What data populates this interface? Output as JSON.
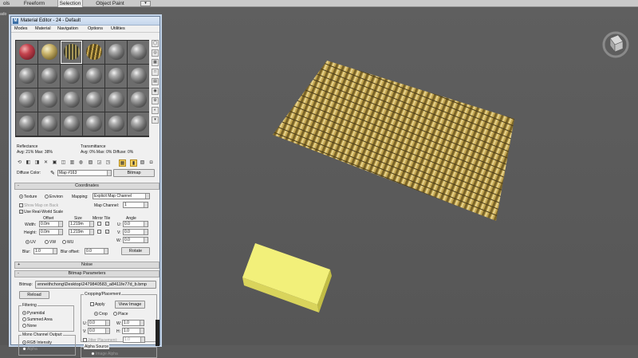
{
  "ribbon": {
    "tabs": [
      "ols",
      "Freeform",
      "Selection",
      "Object Paint"
    ],
    "selected": "Selection",
    "dropdown_glyph": "▾"
  },
  "viewport": {
    "label": "ado"
  },
  "material_editor": {
    "title": "Material Editor - 24 - Default",
    "title_icon": "M",
    "menu": [
      "Modes",
      "Material",
      "Navigation",
      "Options",
      "Utilities"
    ],
    "stats": {
      "reflectance_label": "Reflectance",
      "reflectance_values": "Avg:  21% Max:  38%",
      "transmittance_label": "Transmittance",
      "transmittance_values": "Avg:   0% Max:   0%  Diffuse:   0%"
    },
    "diffuse": {
      "label": "Diffuse Color:",
      "map_name": "Map #163",
      "type": "Bitmap"
    },
    "coordinates": {
      "header": "Coordinates",
      "texture": "Texture",
      "environ": "Environ",
      "mapping_label": "Mapping:",
      "mapping_value": "Explicit Map Channel",
      "show_map_on_back": "Show Map on Back",
      "map_channel_label": "Map Channel:",
      "map_channel_value": "1",
      "use_real_world_scale": "Use Real-World Scale",
      "offset_header": "Offset",
      "size_header": "Size",
      "mirror_tile_header": "Mirror Tile",
      "angle_header": "Angle",
      "width_label": "Width:",
      "width_offset": "0.0m",
      "width_size": "1.219m",
      "height_label": "Height:",
      "height_offset": "0.0m",
      "height_size": "1.219m",
      "u_label": "U:",
      "u_angle": "0.0",
      "v_label": "V:",
      "v_angle": "0.0",
      "w_label": "W:",
      "w_angle": "0.0",
      "uv": "UV",
      "vw": "VW",
      "wu": "WU",
      "blur_label": "Blur:",
      "blur_value": "1.0",
      "blur_offset_label": "Blur offset:",
      "blur_offset_value": "0.0",
      "rotate": "Rotate"
    },
    "noise": {
      "header": "Noise"
    },
    "bitmap_params": {
      "header": "Bitmap Parameters",
      "bitmap_label": "Bitmap:",
      "bitmap_path": "enneithchong\\Desktop\\2479840583_a8411fe77d_b.bmp",
      "reload": "Reload",
      "cropping_label": "Cropping/Placement",
      "apply": "Apply",
      "view_image": "View Image",
      "crop": "Crop",
      "place": "Place",
      "u_label": "U:",
      "u_value": "0.0",
      "w_label": "W:",
      "w_value": "1.0",
      "v_label": "V:",
      "v_value": "0.0",
      "h_label": "H:",
      "h_value": "1.0",
      "jitter_label": "Jitter Placement:",
      "jitter_value": "1.0",
      "filtering_label": "Filtering",
      "pyramidal": "Pyramidal",
      "summed_area": "Summed Area",
      "none": "None",
      "mono_label": "Mono Channel Output:",
      "rgb_intensity": "RGB Intensity",
      "alpha": "Alpha",
      "alpha_source_label": "Alpha Source",
      "image_alpha": "Image Alpha"
    }
  },
  "colors": {
    "accent_active": "#f7d05c",
    "box_yellow": "#f2f07a",
    "plane_texture": "#b89a4a"
  }
}
